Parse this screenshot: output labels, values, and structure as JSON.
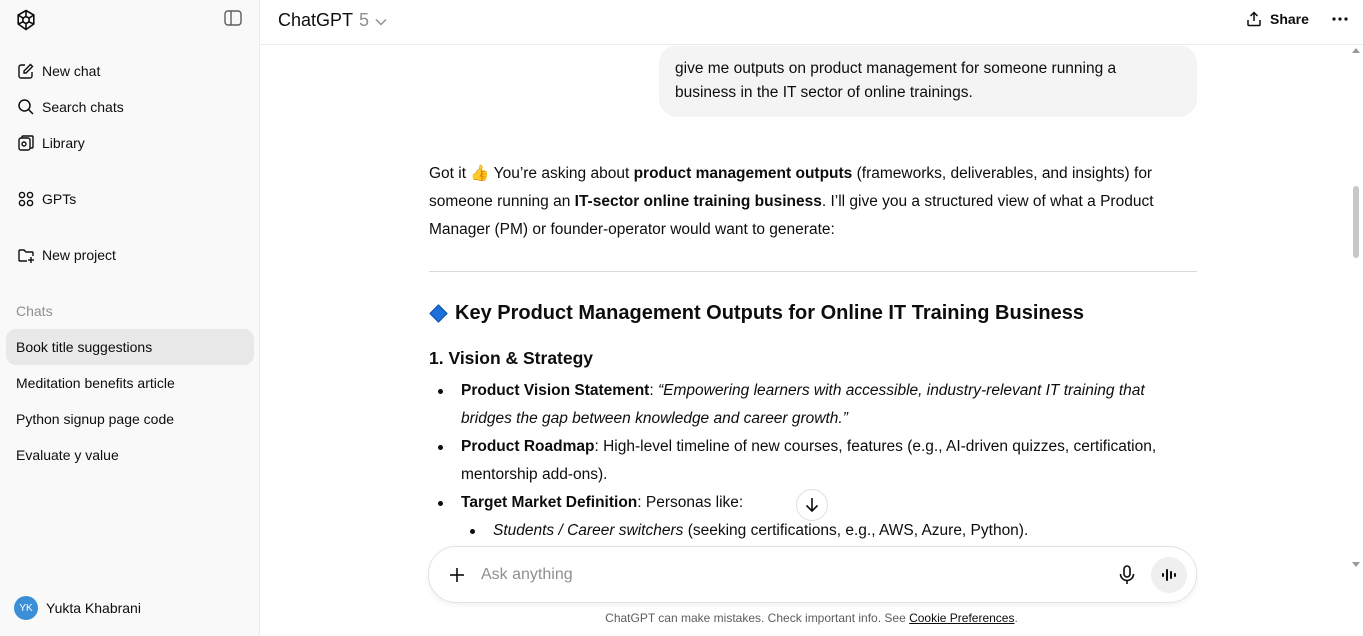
{
  "sidebar": {
    "logo_icon": "openai-logo-icon",
    "toggle_icon": "sidebar-toggle-icon",
    "nav": [
      {
        "label": "New chat",
        "icon": "pencil-square-icon"
      },
      {
        "label": "Search chats",
        "icon": "search-icon"
      },
      {
        "label": "Library",
        "icon": "library-icon"
      },
      {
        "label": "GPTs",
        "icon": "grid-icon"
      },
      {
        "label": "New project",
        "icon": "folder-plus-icon"
      }
    ],
    "section_label": "Chats",
    "chats": [
      {
        "label": "Book title suggestions",
        "active": true
      },
      {
        "label": "Meditation benefits article",
        "active": false
      },
      {
        "label": "Python signup page code",
        "active": false
      },
      {
        "label": "Evaluate y value",
        "active": false
      }
    ],
    "user": {
      "initials": "YK",
      "name": "Yukta Khabrani"
    }
  },
  "header": {
    "model_name": "ChatGPT",
    "model_version": "5",
    "share_label": "Share"
  },
  "conversation": {
    "user_message": "give me outputs on product management for someone running a business in the IT sector of online trainings.",
    "answer_intro": {
      "p1": "Got it 👍 You’re asking about ",
      "b1": "product management outputs",
      "p2": " (frameworks, deliverables, and insights) for someone running an ",
      "b2": "IT-sector online training business",
      "p3": ". I’ll give you a structured view of what a Product Manager (PM) or founder-operator would want to generate:"
    },
    "heading": "Key Product Management Outputs for Online IT Training Business",
    "subheading": "1. Vision & Strategy",
    "bullets": [
      {
        "label": "Product Vision Statement",
        "text": ": ",
        "italic": "“Empowering learners with accessible, industry-relevant IT training that bridges the gap between knowledge and career growth.”"
      },
      {
        "label": "Product Roadmap",
        "text": ": High-level timeline of new courses, features (e.g., AI-driven quizzes, certification, mentorship add-ons)."
      },
      {
        "label": "Target Market Definition",
        "text": ": Personas like:"
      }
    ],
    "sub_bullets": [
      {
        "italic": "Students / Career switchers",
        "text": " (seeking certifications, e.g., AWS, Azure, Python)."
      }
    ]
  },
  "composer": {
    "placeholder": "Ask anything",
    "value": ""
  },
  "footer": {
    "disclaimer": "ChatGPT can make mistakes. Check important info. See ",
    "link": "Cookie Preferences",
    "end": "."
  }
}
